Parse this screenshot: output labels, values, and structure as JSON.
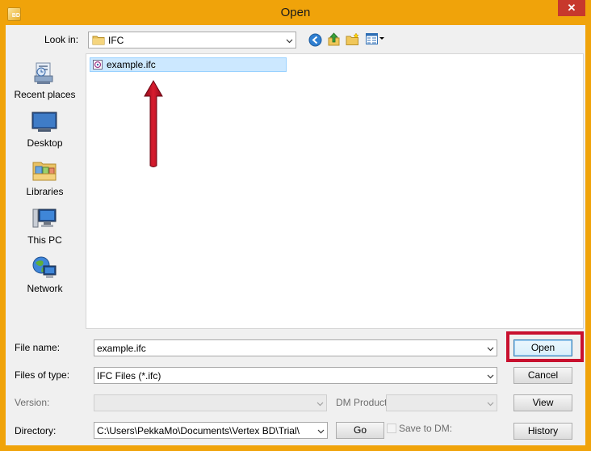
{
  "window": {
    "title": "Open",
    "app_icon_text": "BD",
    "close_glyph": "✕"
  },
  "toolbar": {
    "look_in_label": "Look in:",
    "look_in_value": "IFC",
    "icons": [
      "back-icon",
      "up-folder-icon",
      "new-folder-icon",
      "view-menu-icon"
    ]
  },
  "places": [
    {
      "label": "Recent places",
      "icon": "recent-places-icon"
    },
    {
      "label": "Desktop",
      "icon": "desktop-icon"
    },
    {
      "label": "Libraries",
      "icon": "libraries-icon"
    },
    {
      "label": "This PC",
      "icon": "this-pc-icon"
    },
    {
      "label": "Network",
      "icon": "network-icon"
    }
  ],
  "files": [
    {
      "name": "example.ifc",
      "selected": true
    }
  ],
  "form": {
    "file_name_label": "File name:",
    "file_name_value": "example.ifc",
    "files_of_type_label": "Files of type:",
    "files_of_type_value": "IFC Files (*.ifc)",
    "version_label": "Version:",
    "version_value": "",
    "dm_product_label": "DM Product",
    "dm_product_value": "",
    "directory_label": "Directory:",
    "directory_value": "C:\\Users\\PekkaMo\\Documents\\Vertex BD\\Trial\\",
    "save_to_dm_label": "Save to DM:",
    "save_to_dm_checked": false
  },
  "buttons": {
    "open": "Open",
    "cancel": "Cancel",
    "view": "View",
    "history": "History",
    "go": "Go"
  },
  "colors": {
    "titlebar": "#f0a30a",
    "close": "#c7382c",
    "annotation": "#c8102e",
    "selection": "#cce8ff"
  }
}
